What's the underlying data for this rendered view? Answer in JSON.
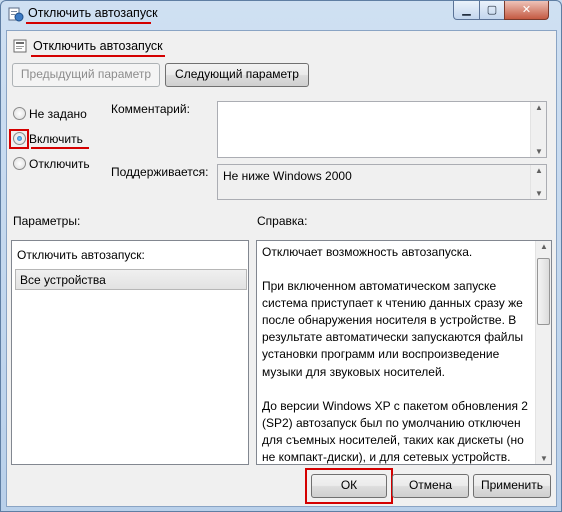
{
  "window": {
    "title": "Отключить автозапуск",
    "icon": "policy-settings-icon",
    "caption_buttons": {
      "minimize": "minimize-icon",
      "maximize": "maximize-icon",
      "close": "close-icon"
    }
  },
  "header": {
    "title": "Отключить автозапуск",
    "icon": "policy-icon"
  },
  "nav": {
    "prev_label": "Предыдущий параметр",
    "next_label": "Следующий параметр"
  },
  "state": {
    "options": [
      {
        "label": "Не задано",
        "checked": false
      },
      {
        "label": "Включить",
        "checked": true
      },
      {
        "label": "Отключить",
        "checked": false
      }
    ]
  },
  "comment": {
    "label": "Комментарий:",
    "value": ""
  },
  "supported": {
    "label": "Поддерживается:",
    "value": "Не ниже Windows 2000"
  },
  "params": {
    "section_label": "Параметры:",
    "field_label": "Отключить автозапуск:",
    "selected_value": "Все устройства"
  },
  "help": {
    "section_label": "Справка:",
    "paragraphs": [
      "Отключает возможность автозапуска.",
      "При включенном автоматическом запуске система приступает к чтению данных сразу же после обнаружения носителя в устройстве. В результате автоматически запускаются файлы установки программ или воспроизведение музыки для звуковых носителей.",
      "До версии Windows XP с пакетом обновления 2 (SP2) автозапуск был по умолчанию отключен для съемных носителей, таких как дискеты (но не компакт-диски), и для сетевых устройств."
    ]
  },
  "footer": {
    "ok_label": "ОК",
    "cancel_label": "Отмена",
    "apply_label": "Применить"
  },
  "colors": {
    "highlight": "#d40000",
    "window_frame": "#b9d0ea",
    "dialog_bg": "#f0f0f0"
  }
}
